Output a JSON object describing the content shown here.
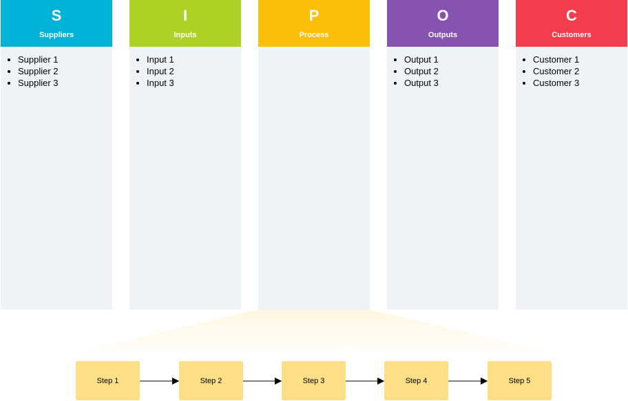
{
  "columns": [
    {
      "letter": "S",
      "title": "Suppliers",
      "color": "#02b2d6",
      "items": [
        "Supplier 1",
        "Supplier 2",
        "Supplier 3"
      ]
    },
    {
      "letter": "I",
      "title": "Inputs",
      "color": "#add124",
      "items": [
        "Input 1",
        "Input 2",
        "Input 3"
      ]
    },
    {
      "letter": "P",
      "title": "Process",
      "color": "#fbbf08",
      "items": []
    },
    {
      "letter": "O",
      "title": "Outputs",
      "color": "#8653b0",
      "items": [
        "Output 1",
        "Output 2",
        "Output 3"
      ]
    },
    {
      "letter": "C",
      "title": "Customers",
      "color": "#f33c4c",
      "items": [
        "Customer 1",
        "Customer 2",
        "Customer 3"
      ]
    }
  ],
  "process_steps": [
    "Step 1",
    "Step 2",
    "Step 3",
    "Step 4",
    "Step 5"
  ],
  "colors": {
    "step_fill": "#fcdf87",
    "column_body": "#eff3f6",
    "arrow": "#333333"
  }
}
